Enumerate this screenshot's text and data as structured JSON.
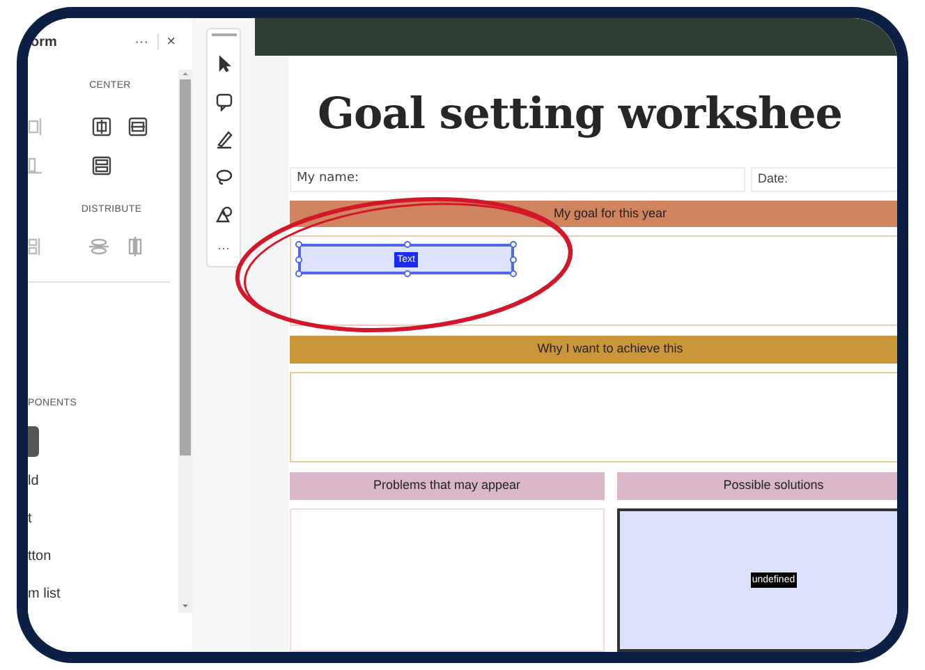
{
  "side_panel": {
    "title": "orm",
    "menu": "···",
    "close": "×",
    "sections": [
      {
        "heading": "CENTER"
      },
      {
        "heading": "DISTRIBUTE"
      }
    ],
    "components_heading": "PONENTS",
    "components": [
      "ld",
      "t",
      "tton",
      "m list"
    ]
  },
  "toolbar": {
    "more": "···"
  },
  "worksheet": {
    "title": "Goal setting workshee",
    "name_label": "My name:",
    "date_label": "Date:",
    "goal": {
      "heading": "My goal for this year",
      "color": "#d08560",
      "field_label": "Text"
    },
    "why": {
      "heading": "Why I want to achieve this",
      "color": "#c9973a"
    },
    "columns": [
      {
        "heading": "Problems that may appear",
        "color": "#dbb6c9",
        "selected": false
      },
      {
        "heading": "Possible solutions",
        "color": "#dbb6c9",
        "selected": true,
        "label": "undefined"
      }
    ]
  }
}
